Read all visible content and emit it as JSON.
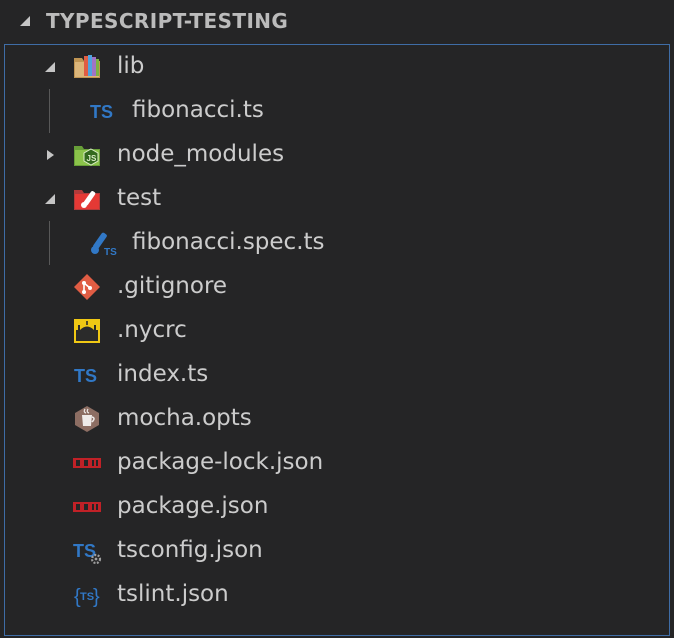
{
  "explorer": {
    "section_title": "TYPESCRIPT-TESTING",
    "items": [
      {
        "label": "lib",
        "icon": "folder-lib-icon",
        "depth": 0,
        "expanded": true
      },
      {
        "label": "fibonacci.ts",
        "icon": "typescript-file-icon",
        "depth": 1
      },
      {
        "label": "node_modules",
        "icon": "folder-node-icon",
        "depth": 0,
        "expanded": false
      },
      {
        "label": "test",
        "icon": "folder-test-icon",
        "depth": 0,
        "expanded": true
      },
      {
        "label": "fibonacci.spec.ts",
        "icon": "test-spec-file-icon",
        "depth": 1
      },
      {
        "label": ".gitignore",
        "icon": "git-icon",
        "depth": 0
      },
      {
        "label": ".nycrc",
        "icon": "istanbul-icon",
        "depth": 0
      },
      {
        "label": "index.ts",
        "icon": "typescript-file-icon",
        "depth": 0
      },
      {
        "label": "mocha.opts",
        "icon": "mocha-icon",
        "depth": 0
      },
      {
        "label": "package-lock.json",
        "icon": "npm-icon",
        "depth": 0
      },
      {
        "label": "package.json",
        "icon": "npm-icon",
        "depth": 0
      },
      {
        "label": "tsconfig.json",
        "icon": "tsconfig-icon",
        "depth": 0
      },
      {
        "label": "tslint.json",
        "icon": "tslint-icon",
        "depth": 0
      }
    ]
  },
  "colors": {
    "background": "#252526",
    "focus_border": "#3f6da6",
    "text": "#cccccc",
    "ts_blue": "#3178c6",
    "git_red": "#e05d44",
    "npm_red": "#c12127"
  }
}
